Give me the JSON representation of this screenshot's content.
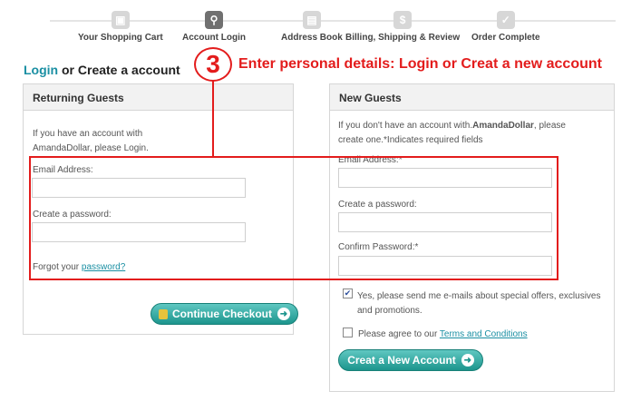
{
  "steps": [
    {
      "label": "Your Shopping Cart",
      "icon": "cart-icon"
    },
    {
      "label": "Account Login",
      "icon": "key-icon"
    },
    {
      "label": "Address Book",
      "icon": "document-icon"
    },
    {
      "label": "Billing, Shipping & Review",
      "icon": "dollar-icon"
    },
    {
      "label": "Order Complete",
      "icon": "check-icon"
    }
  ],
  "title": {
    "login": "Login",
    "rest": " or Create a account"
  },
  "annotation": {
    "number": "3",
    "text": "Enter personal details: Login or Creat a new account"
  },
  "returning": {
    "heading": "Returning Guests",
    "intro": "If you have an account with AmandaDollar, please Login.",
    "email_label": "Email Address:",
    "password_label": "Create a password:",
    "forgot_prefix": "Forgot your ",
    "forgot_link": "password?",
    "button": "Continue Checkout"
  },
  "new_guests": {
    "heading": "New Guests",
    "intro_part1": "If you don't have an account with.",
    "intro_brand": "AmandaDollar",
    "intro_part2": ", please create one.*Indicates required fields",
    "email_label": "Email Address:*",
    "password_label": "Create a password:",
    "confirm_label": "Confirm Password:*",
    "newsletter_text": "Yes, please send me e-mails about special offers, exclusives and promotions.",
    "newsletter_checked": true,
    "terms_prefix": "Please agree to our ",
    "terms_link": "Terms and Conditions",
    "terms_checked": false,
    "button": "Creat a New Account"
  },
  "colors": {
    "accent": "#1a8fa3",
    "annotation": "#e31c1c",
    "button": "#1c958d"
  }
}
